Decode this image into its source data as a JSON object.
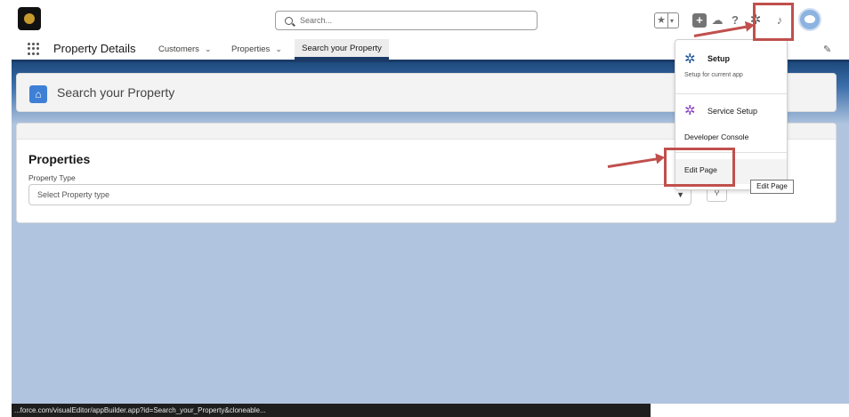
{
  "global_header": {
    "search_placeholder": "Search...",
    "icons": [
      "logo",
      "search-icon",
      "favorites-star-icon",
      "chevron-down-icon",
      "plus-icon",
      "trailhead-icon",
      "help-icon",
      "gear-icon",
      "bell-icon",
      "avatar"
    ],
    "help_glyph": "?"
  },
  "app_nav": {
    "app_name": "Property Details",
    "items": [
      {
        "label": "Customers"
      },
      {
        "label": "Properties"
      }
    ],
    "active_tab": "Search your Property"
  },
  "page_header": {
    "title": "Search your Property"
  },
  "properties_card": {
    "title": "Properties",
    "field_label": "Property Type",
    "select_value": "Select Property type"
  },
  "setup_menu": {
    "setup_label": "Setup",
    "setup_sub": "Setup for current app",
    "service_setup_label": "Service Setup",
    "developer_console_label": "Developer Console",
    "edit_page_label": "Edit Page"
  },
  "tooltip": {
    "text": "Edit Page"
  },
  "status_bar": {
    "url": "...force.com/visualEditor/appBuilder.app?id=Search_your_Property&cloneable..."
  },
  "colors": {
    "nav_underline": "#1b3b66",
    "background_blue": "#b0c4df",
    "highlight_red": "#c0504d",
    "setup_gear": "#1b5297",
    "service_gear": "#8a44c6"
  }
}
